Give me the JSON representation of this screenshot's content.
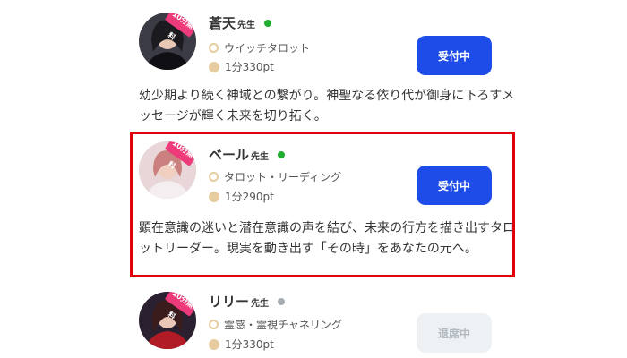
{
  "fortune_tellers": [
    {
      "name": "蒼天",
      "honorific": "先生",
      "online": true,
      "badge": "10分無料",
      "genre": "ウイッチタロット",
      "price": "1分330pt",
      "button": "受付中",
      "description": "幼少期より続く神域との繋がり。神聖なる依り代が御身に下ろすメッセージが輝く未来を切り拓く。"
    },
    {
      "name": "ベール",
      "honorific": "先生",
      "online": true,
      "badge": "10分無料",
      "genre": "タロット・リーディング",
      "price": "1分290pt",
      "button": "受付中",
      "description": "顕在意識の迷いと潜在意識の声を結び、未来の行方を描き出すタロットリーダー。現実を動き出す「その時」をあなたの元へ。"
    },
    {
      "name": "リリー",
      "honorific": "先生",
      "online": false,
      "badge": "10分無料",
      "genre": "霊感・霊視チャネリング",
      "price": "1分330pt",
      "button": "退席中"
    }
  ],
  "colors": {
    "highlight_border": "#e0000d",
    "button_active": "#1e4ce8",
    "button_inactive_bg": "#edf1f4",
    "status_online": "#1fae2e",
    "status_offline": "#a7aeb3"
  }
}
